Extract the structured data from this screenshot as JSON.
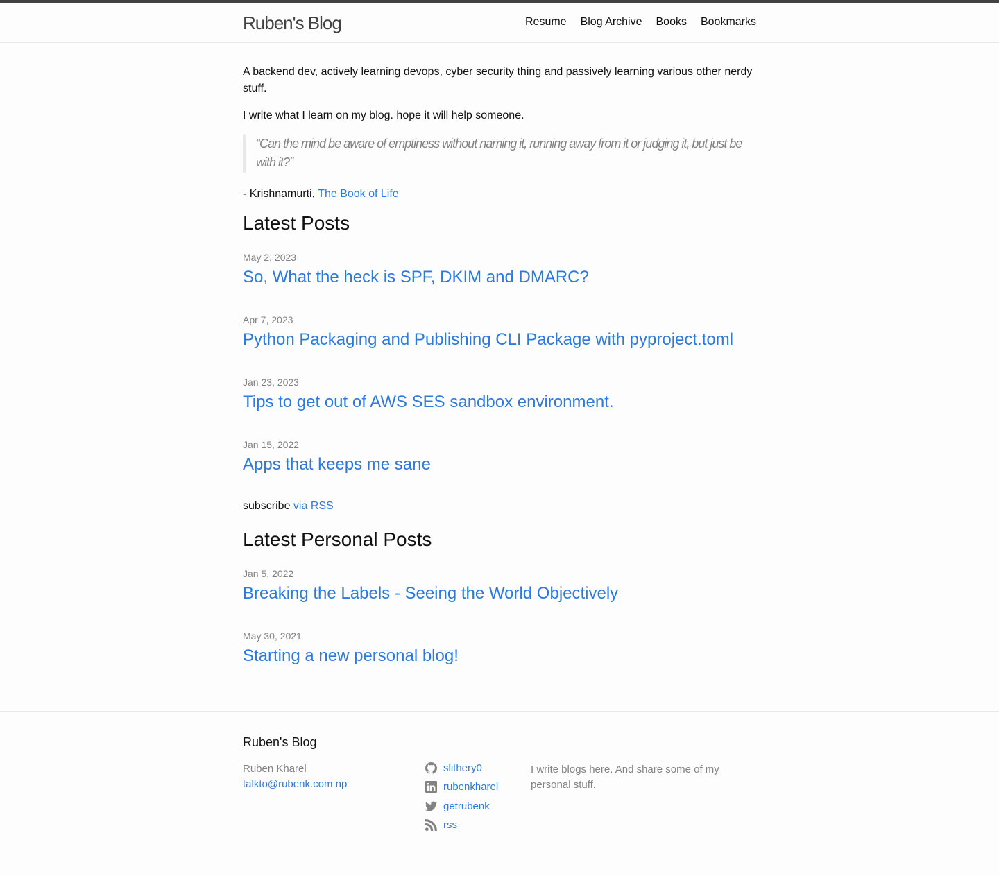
{
  "header": {
    "site_title": "Ruben's Blog",
    "nav": [
      "Resume",
      "Blog Archive",
      "Books",
      "Bookmarks"
    ]
  },
  "intro": {
    "p1": "A backend dev, actively learning devops, cyber security thing and passively learning various other nerdy stuff.",
    "p2": "I write what I learn on my blog. hope it will help someone.",
    "quote": "“Can the mind be aware of emptiness without naming it, running away from it or judging it, but just be with it?”",
    "attribution_prefix": "- Krishnamurti, ",
    "attribution_link": "The Book of Life"
  },
  "latest_posts": {
    "heading": "Latest Posts",
    "posts": [
      {
        "date": "May 2, 2023",
        "title": "So, What the heck is SPF, DKIM and DMARC?"
      },
      {
        "date": "Apr 7, 2023",
        "title": "Python Packaging and Publishing CLI Package with pyproject.toml"
      },
      {
        "date": "Jan 23, 2023",
        "title": "Tips to get out of AWS SES sandbox environment."
      },
      {
        "date": "Jan 15, 2022",
        "title": "Apps that keeps me sane"
      }
    ],
    "subscribe_text": "subscribe ",
    "subscribe_link": "via RSS"
  },
  "personal_posts": {
    "heading": "Latest Personal Posts",
    "posts": [
      {
        "date": "Jan 5, 2022",
        "title": "Breaking the Labels - Seeing the World Objectively"
      },
      {
        "date": "May 30, 2021",
        "title": "Starting a new personal blog!"
      }
    ]
  },
  "footer": {
    "title": "Ruben's Blog",
    "name": "Ruben Kharel",
    "email": "talkto@rubenk.com.np",
    "social": [
      {
        "icon": "github-icon",
        "label": "slithery0"
      },
      {
        "icon": "linkedin-icon",
        "label": "rubenkharel"
      },
      {
        "icon": "twitter-icon",
        "label": "getrubenk"
      },
      {
        "icon": "rss-icon",
        "label": "rss"
      }
    ],
    "description": "I write blogs here. And share some of my personal stuff."
  },
  "colors": {
    "link": "#2a7ae2",
    "topbar": "#424242",
    "muted": "#828282"
  }
}
